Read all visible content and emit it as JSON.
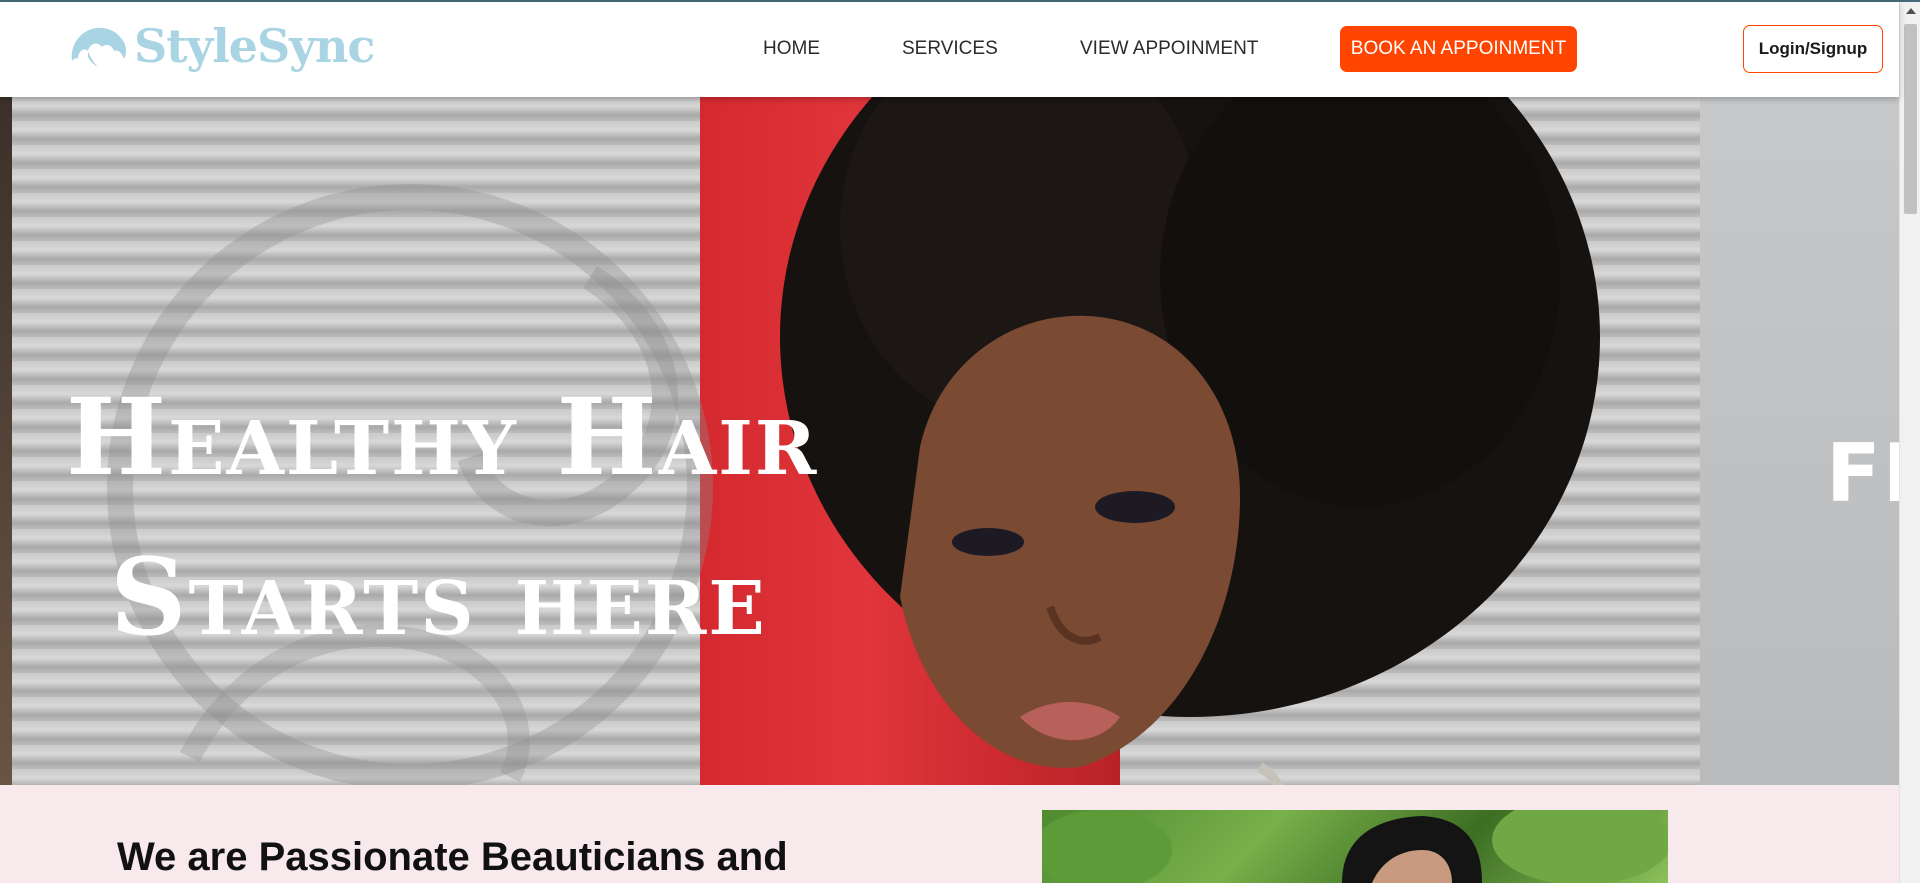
{
  "header": {
    "logo_text": "StyleSync",
    "nav": {
      "home": "HOME",
      "services": "SERVICES",
      "view_appointment": "VIEW APPOINMENT"
    },
    "book_button": "BOOK AN APPOINMENT",
    "login_button": "Login/Signup"
  },
  "hero": {
    "title_line1": "Healthy Hair",
    "title_line2": "Starts here",
    "next_slide_partial_text": "FI"
  },
  "about": {
    "heading": "We are Passionate Beauticians and"
  },
  "colors": {
    "accent": "#ff4500",
    "logo": "#a9d4e4",
    "section_bg": "#f8e9ec"
  },
  "icons": {
    "logo": "hair-silhouette-icon"
  }
}
